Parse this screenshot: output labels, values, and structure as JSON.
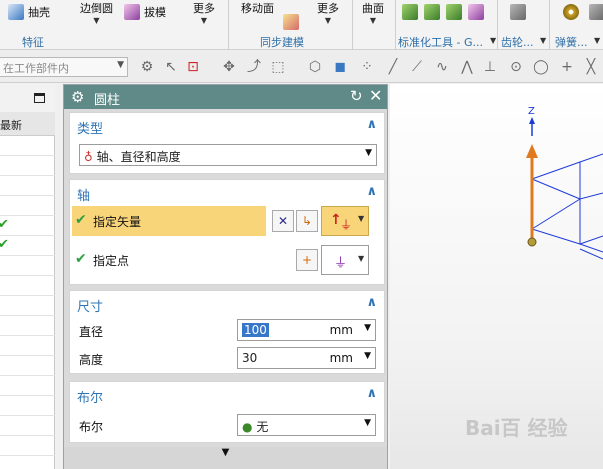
{
  "ribbon": {
    "shell": "抽壳",
    "edge_blend": "边倒圆",
    "draft": "拔模",
    "more1": "更多",
    "move_face": "移动面",
    "more2": "更多",
    "surface": "曲面",
    "group_feature": "特征",
    "group_sync": "同步建模",
    "group_std": "标准化工具 - G...",
    "group_gear": "齿轮...",
    "group_spring": "弹簧..."
  },
  "selection_bar": {
    "scope": "在工作部件内"
  },
  "navigator": {
    "column_header": "最新"
  },
  "dialog": {
    "title": "圆柱",
    "type_section": {
      "title": "类型",
      "value": "轴、直径和高度"
    },
    "axis_section": {
      "title": "轴",
      "specify_vector": "指定矢量",
      "specify_point": "指定点"
    },
    "dimensions_section": {
      "title": "尺寸",
      "diameter_label": "直径",
      "diameter_value": "100",
      "diameter_unit": "mm",
      "height_label": "高度",
      "height_value": "30",
      "height_unit": "mm"
    },
    "boolean_section": {
      "title": "布尔",
      "label": "布尔",
      "value": "无"
    }
  },
  "viewport": {
    "axis_label": "Z"
  },
  "watermark": "Bai百 经验"
}
